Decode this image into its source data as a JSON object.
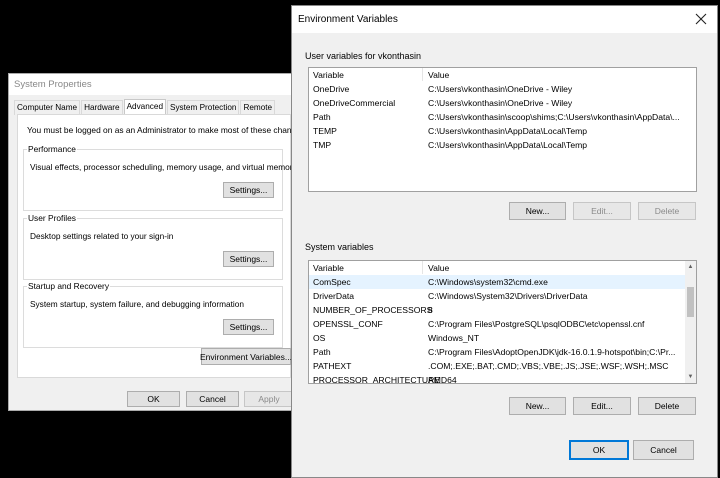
{
  "system_properties": {
    "title": "System Properties",
    "tabs": [
      "Computer Name",
      "Hardware",
      "Advanced",
      "System Protection",
      "Remote"
    ],
    "active_tab": "Advanced",
    "admin_note": "You must be logged on as an Administrator to make most of these changes.",
    "performance": {
      "title": "Performance",
      "desc": "Visual effects, processor scheduling, memory usage, and virtual memory",
      "button": "Settings..."
    },
    "user_profiles": {
      "title": "User Profiles",
      "desc": "Desktop settings related to your sign-in",
      "button": "Settings..."
    },
    "startup_recovery": {
      "title": "Startup and Recovery",
      "desc": "System startup, system failure, and debugging information",
      "button": "Settings..."
    },
    "env_button": "Environment Variables...",
    "ok": "OK",
    "cancel": "Cancel",
    "apply": "Apply"
  },
  "environment_variables": {
    "title": "Environment Variables",
    "user_section": "User variables for vkonthasin",
    "columns": {
      "variable": "Variable",
      "value": "Value"
    },
    "user_vars": [
      {
        "name": "OneDrive",
        "value": "C:\\Users\\vkonthasin\\OneDrive - Wiley"
      },
      {
        "name": "OneDriveCommercial",
        "value": "C:\\Users\\vkonthasin\\OneDrive - Wiley"
      },
      {
        "name": "Path",
        "value": "C:\\Users\\vkonthasin\\scoop\\shims;C:\\Users\\vkonthasin\\AppData\\..."
      },
      {
        "name": "TEMP",
        "value": "C:\\Users\\vkonthasin\\AppData\\Local\\Temp"
      },
      {
        "name": "TMP",
        "value": "C:\\Users\\vkonthasin\\AppData\\Local\\Temp"
      }
    ],
    "user_buttons": {
      "new": "New...",
      "edit": "Edit...",
      "delete": "Delete"
    },
    "system_section": "System variables",
    "system_vars": [
      {
        "name": "ComSpec",
        "value": "C:\\Windows\\system32\\cmd.exe"
      },
      {
        "name": "DriverData",
        "value": "C:\\Windows\\System32\\Drivers\\DriverData"
      },
      {
        "name": "NUMBER_OF_PROCESSORS",
        "value": "8"
      },
      {
        "name": "OPENSSL_CONF",
        "value": "C:\\Program Files\\PostgreSQL\\psqlODBC\\etc\\openssl.cnf"
      },
      {
        "name": "OS",
        "value": "Windows_NT"
      },
      {
        "name": "Path",
        "value": "C:\\Program Files\\AdoptOpenJDK\\jdk-16.0.1.9-hotspot\\bin;C:\\Pr..."
      },
      {
        "name": "PATHEXT",
        "value": ".COM;.EXE;.BAT;.CMD;.VBS;.VBE;.JS;.JSE;.WSF;.WSH;.MSC"
      },
      {
        "name": "PROCESSOR_ARCHITECTURE",
        "value": "AMD64"
      }
    ],
    "system_buttons": {
      "new": "New...",
      "edit": "Edit...",
      "delete": "Delete"
    },
    "ok": "OK",
    "cancel": "Cancel"
  },
  "colors": {
    "background": "#000000",
    "window": "#f0f0f0",
    "selection": "#e5f3ff",
    "accent": "#0078d7"
  },
  "icons": [
    "close-icon",
    "scroll-up-icon",
    "scroll-down-icon"
  ]
}
